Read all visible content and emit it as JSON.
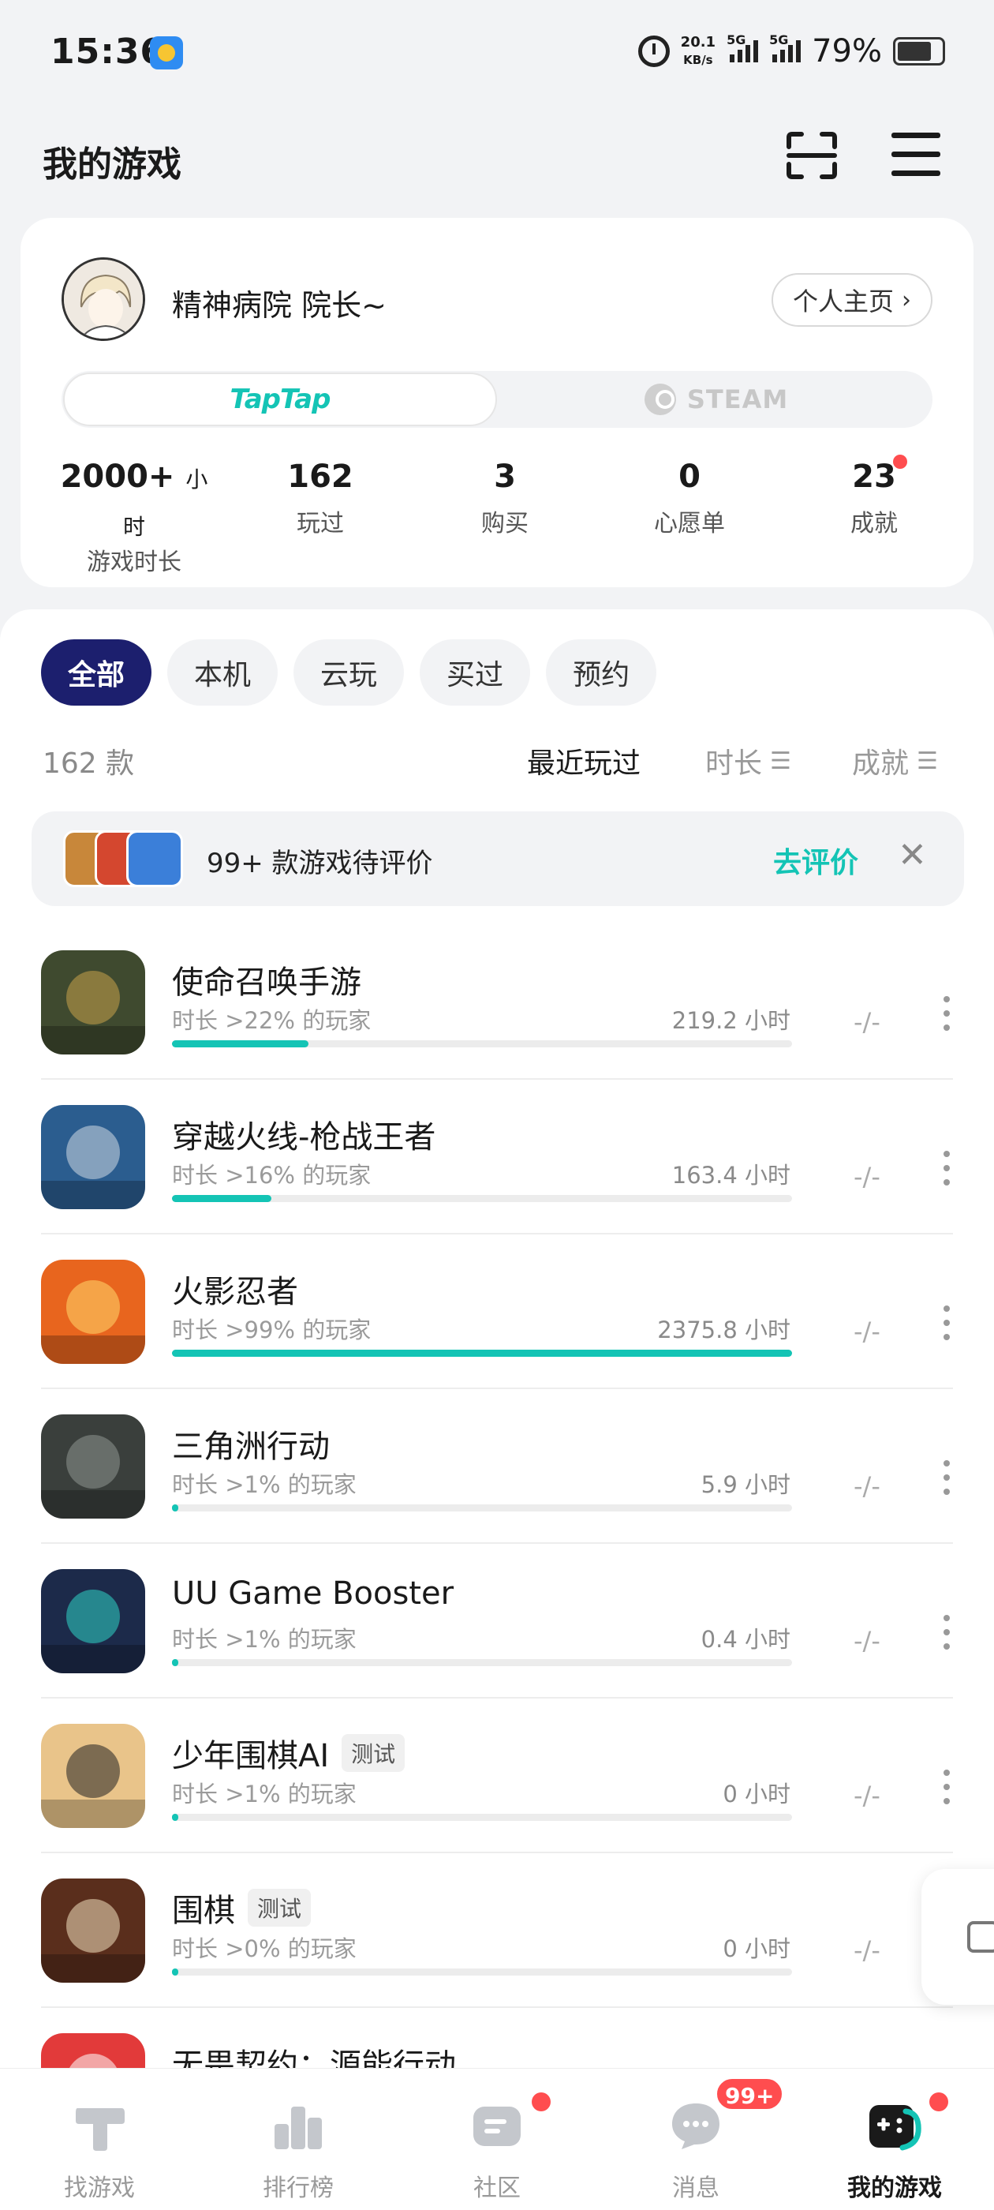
{
  "status_bar": {
    "time": "15:36",
    "net_speed_value": "20.1",
    "net_speed_unit": "KB/s",
    "sim1": "5G",
    "sim2": "5G",
    "battery": "79%"
  },
  "header": {
    "title": "我的游戏",
    "scan_icon": "scan-icon",
    "menu_icon": "menu-icon"
  },
  "profile": {
    "nickname": "精神病院 院长~",
    "home_button": "个人主页",
    "platforms": {
      "taptap": "TapTap",
      "steam": "STEAM"
    },
    "stats": [
      {
        "value": "2000+",
        "unit": "小时",
        "label": "游戏时长"
      },
      {
        "value": "162",
        "unit": "",
        "label": "玩过"
      },
      {
        "value": "3",
        "unit": "",
        "label": "购买"
      },
      {
        "value": "0",
        "unit": "",
        "label": "心愿单"
      },
      {
        "value": "23",
        "unit": "",
        "label": "成就"
      }
    ]
  },
  "filters": [
    "全部",
    "本机",
    "云玩",
    "买过",
    "预约"
  ],
  "list_meta": {
    "count": "162 款",
    "sort_recent": "最近玩过",
    "sort_duration": "时长",
    "sort_achievement": "成就"
  },
  "review_banner": {
    "text": "99+ 款游戏待评价",
    "action": "去评价",
    "close_icon": "close-icon"
  },
  "games": [
    {
      "name": "使命召唤手游",
      "tag": "",
      "pct_text": "时长 >22% 的玩家",
      "hours": "219.2 小时",
      "progress": 0.22,
      "rating": "-/-",
      "icon_bg": "#3f4a2f",
      "icon_accent": "#c9a24a"
    },
    {
      "name": "穿越火线-枪战王者",
      "tag": "",
      "pct_text": "时长 >16% 的玩家",
      "hours": "163.4 小时",
      "progress": 0.16,
      "rating": "-/-",
      "icon_bg": "#2b5d8f",
      "icon_accent": "#cfd8e3"
    },
    {
      "name": "火影忍者",
      "tag": "",
      "pct_text": "时长 >99% 的玩家",
      "hours": "2375.8 小时",
      "progress": 1.0,
      "rating": "-/-",
      "icon_bg": "#e8651e",
      "icon_accent": "#ffd86b"
    },
    {
      "name": "三角洲行动",
      "tag": "",
      "pct_text": "时长 >1% 的玩家",
      "hours": "5.9 小时",
      "progress": 0.01,
      "rating": "-/-",
      "icon_bg": "#3a3f3c",
      "icon_accent": "#8e9690"
    },
    {
      "name": "UU Game Booster",
      "tag": "",
      "pct_text": "时长 >1% 的玩家",
      "hours": "0.4 小时",
      "progress": 0.01,
      "rating": "-/-",
      "icon_bg": "#1c2a4a",
      "icon_accent": "#2fd3c7"
    },
    {
      "name": "少年围棋AI",
      "tag": "测试",
      "pct_text": "时长 >1% 的玩家",
      "hours": "0 小时",
      "progress": 0.01,
      "rating": "-/-",
      "icon_bg": "#e9c48a",
      "icon_accent": "#222222"
    },
    {
      "name": "围棋",
      "tag": "测试",
      "pct_text": "时长 >0% 的玩家",
      "hours": "0 小时",
      "progress": 0.0,
      "rating": "-/-",
      "icon_bg": "#5a2e1c",
      "icon_accent": "#f3e2c0"
    },
    {
      "name": "无畏契约：源能行动",
      "tag": "",
      "pct_text": "",
      "hours": "",
      "progress": 0.0,
      "rating": "",
      "icon_bg": "#e23a3a",
      "icon_accent": "#ffffff"
    }
  ],
  "bottom_nav": [
    {
      "label": "找游戏",
      "icon": "find-games-icon",
      "badge": ""
    },
    {
      "label": "排行榜",
      "icon": "ranking-icon",
      "badge": ""
    },
    {
      "label": "社区",
      "icon": "community-icon",
      "badge": "dot"
    },
    {
      "label": "消息",
      "icon": "message-icon",
      "badge": "99+"
    },
    {
      "label": "我的游戏",
      "icon": "my-games-icon",
      "badge": "dot"
    }
  ],
  "colors": {
    "accent": "#14c4b5",
    "active_chip": "#1c1f6e",
    "badge": "#ff4d4f"
  }
}
